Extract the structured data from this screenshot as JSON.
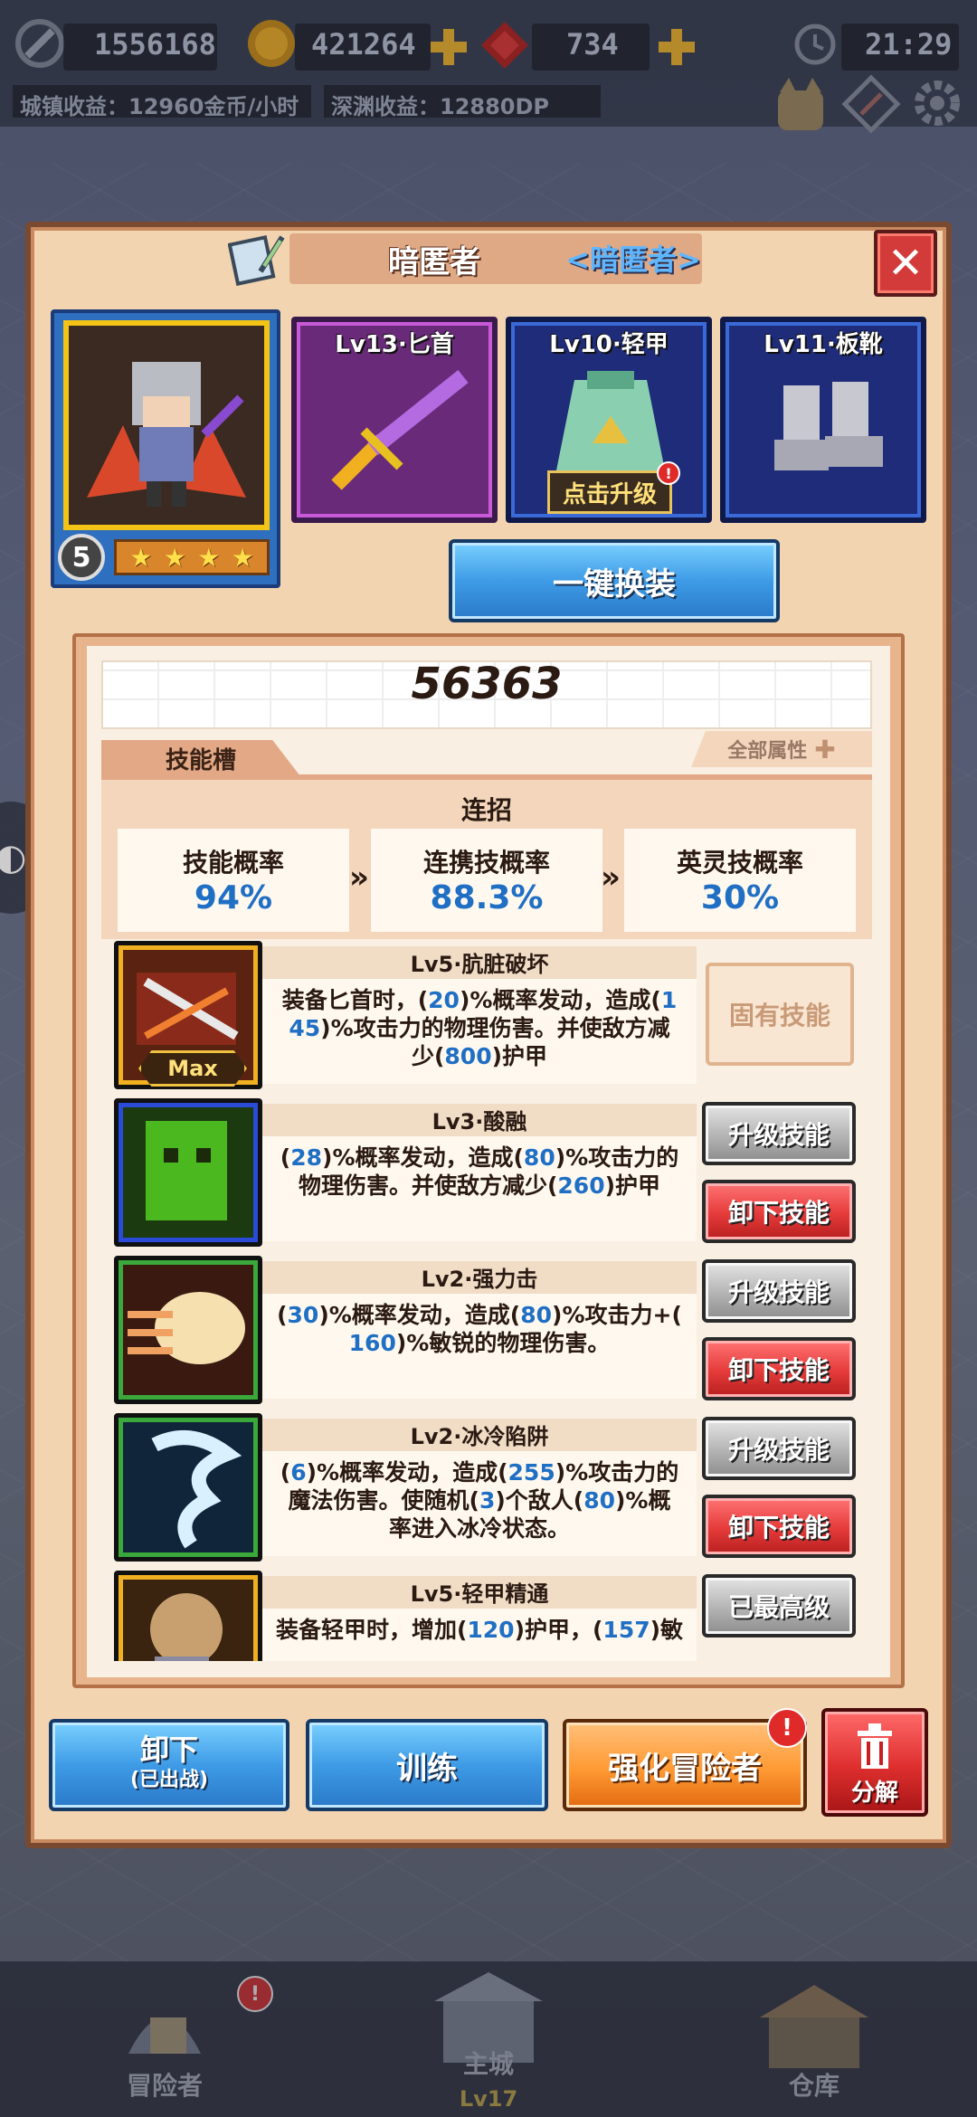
{
  "top": {
    "gold_value": "1556168",
    "coin_value": "421264",
    "gem_value": "734",
    "time": "21:29",
    "town_income": "城镇收益：12960金币/小时",
    "abyss_income": "深渊收益：12880DP"
  },
  "hero": {
    "name": "暗匿者",
    "class_tag": "<暗匿者>",
    "level_badge": "5",
    "stars": [
      "★",
      "★",
      "★",
      "★"
    ]
  },
  "equipment": [
    {
      "label": "Lv13·匕首"
    },
    {
      "label": "Lv10·轻甲",
      "upgrade_tag": "点击升级"
    },
    {
      "label": "Lv11·板靴"
    }
  ],
  "one_click_equip": "一键换装",
  "power": "56363",
  "tab_skills": "技能槽",
  "all_attributes": "全部属性",
  "combo": {
    "title": "连招",
    "rates": [
      {
        "label": "技能概率",
        "value": "94%"
      },
      {
        "label": "连携技概率",
        "value": "88.3%"
      },
      {
        "label": "英灵技概率",
        "value": "30%"
      }
    ],
    "chevron": "»"
  },
  "skills": [
    {
      "name": "Lv5·肮脏破坏",
      "desc_parts": [
        [
          "t",
          "装备匕首时，("
        ],
        [
          "n",
          "20"
        ],
        [
          "t",
          ")%概率发动，造成("
        ],
        [
          "n",
          "1"
        ],
        [
          "br",
          ""
        ],
        [
          "n",
          "45"
        ],
        [
          "t",
          ")%攻击力的物理伤害。并使敌方减"
        ],
        [
          "br",
          ""
        ],
        [
          "t",
          "少("
        ],
        [
          "n",
          "800"
        ],
        [
          "t",
          ")护甲"
        ]
      ],
      "max_tag": "Max",
      "buttons": [
        {
          "label": "固有技能",
          "style": "inh"
        }
      ]
    },
    {
      "name": "Lv3·酸融",
      "desc_parts": [
        [
          "t",
          "("
        ],
        [
          "n",
          "28"
        ],
        [
          "t",
          ")%概率发动，造成("
        ],
        [
          "n",
          "80"
        ],
        [
          "t",
          ")%攻击力的"
        ],
        [
          "br",
          ""
        ],
        [
          "t",
          "物理伤害。并使敌方减少("
        ],
        [
          "n",
          "260"
        ],
        [
          "t",
          ")护甲"
        ]
      ],
      "buttons": [
        {
          "label": "升级技能",
          "style": "gray"
        },
        {
          "label": "卸下技能",
          "style": "red"
        }
      ]
    },
    {
      "name": "Lv2·强力击",
      "desc_parts": [
        [
          "t",
          "("
        ],
        [
          "n",
          "30"
        ],
        [
          "t",
          ")%概率发动，造成("
        ],
        [
          "n",
          "80"
        ],
        [
          "t",
          ")%攻击力+("
        ],
        [
          "br",
          ""
        ],
        [
          "n",
          "160"
        ],
        [
          "t",
          ")%敏锐的物理伤害。"
        ]
      ],
      "buttons": [
        {
          "label": "升级技能",
          "style": "gray"
        },
        {
          "label": "卸下技能",
          "style": "red"
        }
      ]
    },
    {
      "name": "Lv2·冰冷陷阱",
      "desc_parts": [
        [
          "t",
          "("
        ],
        [
          "n",
          "6"
        ],
        [
          "t",
          ")%概率发动，造成("
        ],
        [
          "n",
          "255"
        ],
        [
          "t",
          ")%攻击力的"
        ],
        [
          "br",
          ""
        ],
        [
          "t",
          "魔法伤害。使随机("
        ],
        [
          "n",
          "3"
        ],
        [
          "t",
          ")个敌人("
        ],
        [
          "n",
          "80"
        ],
        [
          "t",
          ")%概"
        ],
        [
          "br",
          ""
        ],
        [
          "t",
          "率进入冰冷状态。"
        ]
      ],
      "buttons": [
        {
          "label": "升级技能",
          "style": "gray"
        },
        {
          "label": "卸下技能",
          "style": "red"
        }
      ]
    },
    {
      "name": "Lv5·轻甲精通",
      "desc_parts": [
        [
          "t",
          "装备轻甲时，增加("
        ],
        [
          "n",
          "120"
        ],
        [
          "t",
          ")护甲，("
        ],
        [
          "n",
          "157"
        ],
        [
          "t",
          ")敏"
        ]
      ],
      "buttons": [
        {
          "label": "已最高级",
          "style": "gray"
        }
      ]
    }
  ],
  "bottom_buttons": {
    "unequip": "卸下",
    "unequip_sub": "(已出战)",
    "train": "训练",
    "enhance": "强化冒险者",
    "decompose": "分解"
  },
  "nav": {
    "adventurer": "冒险者",
    "main_city": "主城",
    "main_city_level": "Lv17",
    "warehouse": "仓库"
  },
  "colors": {
    "panel": "#f3d4b0",
    "accent_blue": "#1f6fc4",
    "button_blue": "#3e9be6",
    "button_red": "#e53a3a",
    "button_orange": "#ff9a34"
  }
}
